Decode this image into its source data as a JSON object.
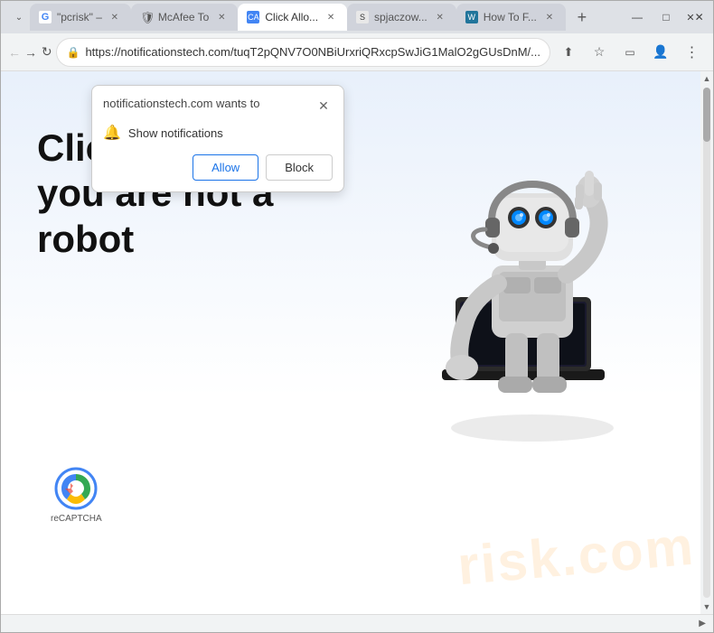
{
  "browser": {
    "tabs": [
      {
        "id": "tab-pcrisk",
        "label": "\"pcrisk\" –",
        "favicon": "G",
        "favicon_type": "g",
        "active": false
      },
      {
        "id": "tab-mcafee",
        "label": "McAfee To",
        "favicon": "M",
        "favicon_type": "shield",
        "active": false
      },
      {
        "id": "tab-click-allow",
        "label": "Click Allo...",
        "favicon": "CA",
        "favicon_type": "click",
        "active": true
      },
      {
        "id": "tab-spjaczow",
        "label": "spjaczow...",
        "favicon": "S",
        "favicon_type": "sp",
        "active": false
      },
      {
        "id": "tab-howto",
        "label": "How To F...",
        "favicon": "W",
        "favicon_type": "wp",
        "active": false
      }
    ],
    "new_tab_label": "+",
    "address_bar": {
      "url": "https://notificationstech.com/tuqT2pQNV7O0NBiUrxriQRxcpSwJiG1MalO2gGUsDnM/..."
    },
    "controls": {
      "minimize": "—",
      "maximize": "□",
      "close": "✕",
      "chevron_down": "⌄"
    }
  },
  "notification_popup": {
    "title": "notificationstech.com wants to",
    "close_label": "✕",
    "item_label": "Show notifications",
    "allow_button": "Allow",
    "block_button": "Block"
  },
  "page": {
    "heading_line1": "Click Allow if",
    "heading_line2": "you are not a",
    "heading_line3": "robot",
    "recaptcha_label": "reCAPTCHA",
    "watermark": "risk.com"
  },
  "colors": {
    "allow_button_color": "#1a73e8",
    "page_bg_top": "#e8f0fb",
    "page_bg_bottom": "#ffffff",
    "watermark_color": "rgba(255,140,0,0.12)"
  }
}
